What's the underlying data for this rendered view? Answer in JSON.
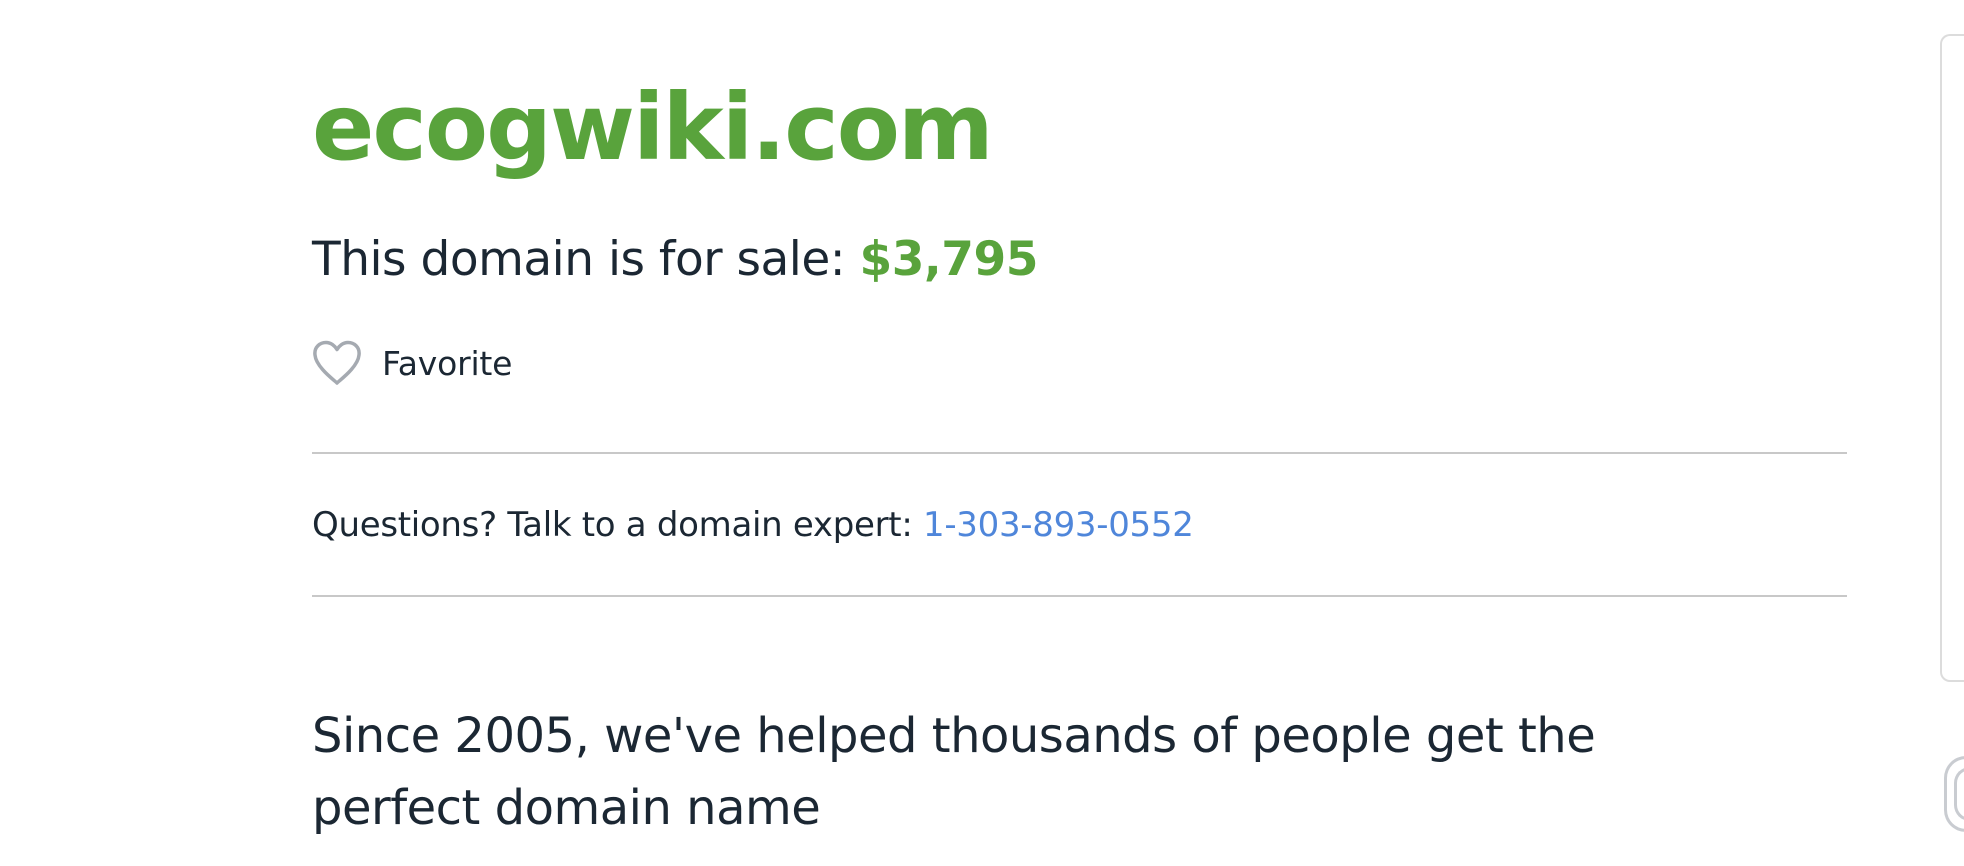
{
  "domain": {
    "name": "ecogwiki.com"
  },
  "sale": {
    "prefix": "This domain is for sale: ",
    "price": "$3,795"
  },
  "favorite": {
    "label": "Favorite",
    "icon": "heart-outline-icon"
  },
  "contact": {
    "prefix": "Questions? Talk to a domain expert: ",
    "phone": "1-303-893-0552"
  },
  "marketing": {
    "heading": "Since 2005, we've helped thousands of people get the perfect domain name"
  },
  "colors": {
    "brand_green": "#59a33c",
    "link_blue": "#4f86da",
    "text_dark": "#1b2733",
    "divider": "#c8c8c8"
  }
}
